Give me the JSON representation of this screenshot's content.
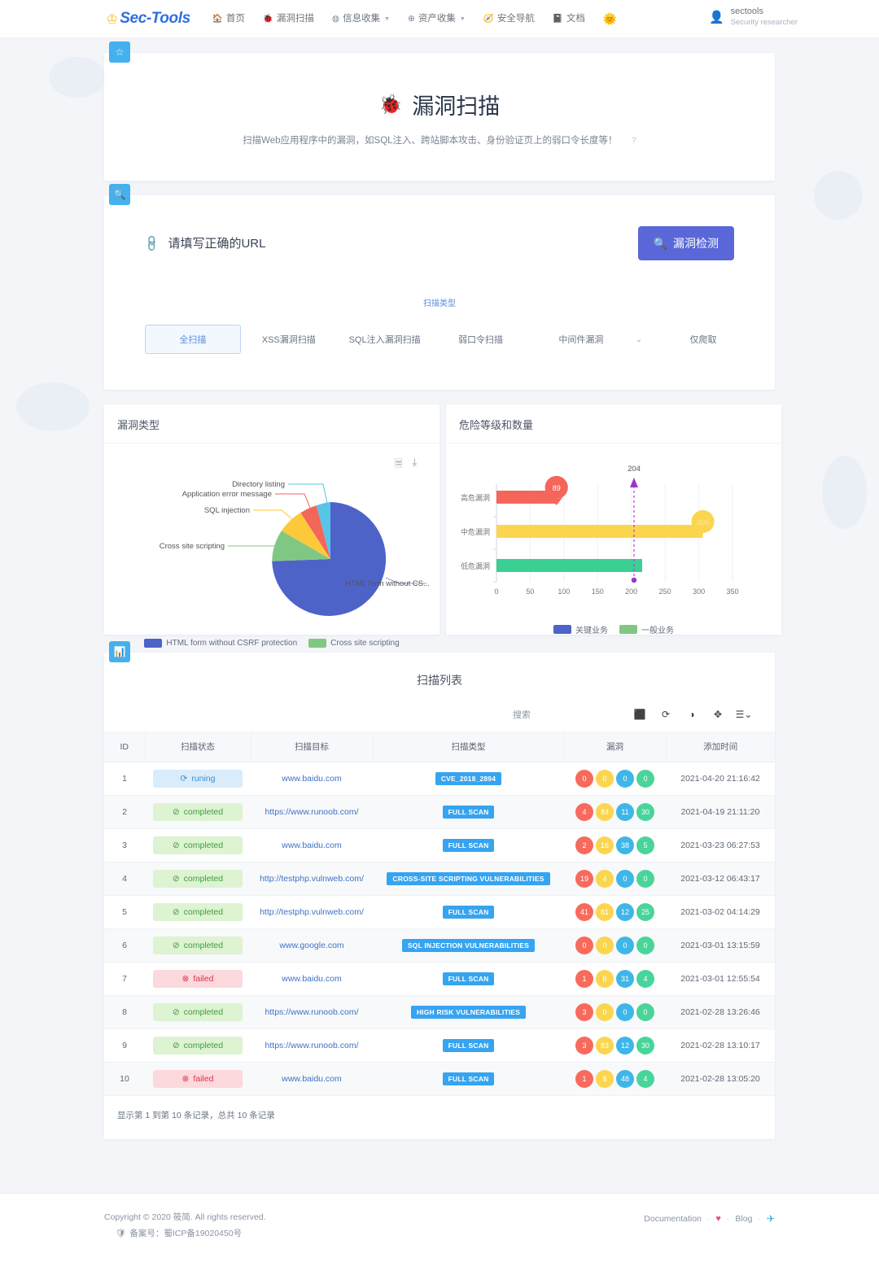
{
  "nav": {
    "brand": "Sec-Tools",
    "crown_icon": "crown-icon",
    "items": [
      {
        "label": "首页",
        "icon": "home-icon",
        "caret": false
      },
      {
        "label": "漏洞扫描",
        "icon": "bug-icon",
        "caret": false
      },
      {
        "label": "信息收集",
        "icon": "globe-icon",
        "caret": true
      },
      {
        "label": "资产收集",
        "icon": "network-icon",
        "caret": true
      },
      {
        "label": "安全导航",
        "icon": "compass-icon",
        "caret": false
      },
      {
        "label": "文档",
        "icon": "book-icon",
        "caret": false
      }
    ],
    "emoji": "🌞",
    "user": {
      "name": "sectools",
      "role": "Security researcher",
      "avatar_icon": "user-avatar-icon"
    }
  },
  "hero": {
    "title": "漏洞扫描",
    "icon": "bug-icon",
    "subtitle": "扫描Web应用程序中的漏洞，如SQL注入、跨站脚本攻击、身份验证页上的弱口令长度等！",
    "help": "?",
    "tab_icon": "star-icon"
  },
  "form": {
    "tab_icon": "search-icon",
    "url_placeholder": "请填写正确的URL",
    "url_value": "",
    "link_icon": "link-icon",
    "scan_button": "漏洞检测",
    "scan_button_icon": "search-icon",
    "scan_type_label": "扫描类型",
    "types": [
      "全扫描",
      "XSS漏洞扫描",
      "SQL注入漏洞扫描",
      "弱口令扫描"
    ],
    "active_type": "全扫描",
    "select_value": "中间件漏洞",
    "crawl_only": "仅爬取"
  },
  "charts": {
    "pie_title": "漏洞类型",
    "bar_title": "危险等级和数量",
    "tools": [
      "document-icon",
      "download-icon"
    ]
  },
  "chart_data": [
    {
      "type": "pie",
      "title": "漏洞类型",
      "categories": [
        "HTML form without CSRF protection",
        "Cross site scripting",
        "SQL injection",
        "Application error message",
        "Directory listing"
      ],
      "values": [
        68,
        15,
        8,
        5,
        4
      ],
      "colors": [
        "#4e63c8",
        "#81c784",
        "#fcc93b",
        "#f4655a",
        "#58c4e8"
      ],
      "labels": [
        "HTML form without CS...",
        "Cross site scripting",
        "SQL injection",
        "Application error message",
        "Directory listing"
      ],
      "legend": [
        "HTML form without CSRF protection",
        "Cross site scripting",
        "SQL injection",
        "Application error message",
        "Directory listing"
      ],
      "legend_position": "bottom"
    },
    {
      "type": "bar",
      "orientation": "horizontal",
      "title": "危险等级和数量",
      "categories": [
        "高危漏洞",
        "中危漏洞",
        "低危漏洞"
      ],
      "values": [
        89,
        306,
        216
      ],
      "markers": [
        "89",
        "306",
        ""
      ],
      "colors": [
        "#f4655a",
        "#fcd54f",
        "#3ccf93"
      ],
      "xlabel": "",
      "ylabel": "",
      "xlim": [
        0,
        350
      ],
      "xticks": [
        0,
        50,
        100,
        150,
        200,
        250,
        300,
        350
      ],
      "threshold": {
        "value": 204,
        "label": "204",
        "color": "#c33bd4"
      },
      "legend": [
        {
          "name": "关键业务",
          "color": "#4e63c8"
        },
        {
          "name": "一般业务",
          "color": "#81c784"
        }
      ],
      "legend_position": "bottom",
      "grid": true
    }
  ],
  "list": {
    "tab_icon": "chart-icon",
    "title": "扫描列表",
    "search_placeholder": "搜索",
    "toolbar_icons": [
      "export-icon",
      "refresh-icon",
      "toggle-icon",
      "fullscreen-icon",
      "columns-icon"
    ],
    "columns": [
      "ID",
      "扫描状态",
      "扫描目标",
      "扫描类型",
      "漏洞",
      "添加时间"
    ],
    "rows": [
      {
        "id": "1",
        "status": "runing",
        "status_kind": "running",
        "target": "www.baidu.com",
        "type": "CVE_2018_2894",
        "vulns": [
          "0",
          "0",
          "0",
          "0"
        ],
        "time": "2021-04-20 21:16:42"
      },
      {
        "id": "2",
        "status": "completed",
        "status_kind": "completed",
        "target": "https://www.runoob.com/",
        "type": "FULL SCAN",
        "vulns": [
          "4",
          "84",
          "11",
          "30"
        ],
        "time": "2021-04-19 21:11:20"
      },
      {
        "id": "3",
        "status": "completed",
        "status_kind": "completed",
        "target": "www.baidu.com",
        "type": "FULL SCAN",
        "vulns": [
          "2",
          "16",
          "38",
          "5"
        ],
        "time": "2021-03-23 06:27:53"
      },
      {
        "id": "4",
        "status": "completed",
        "status_kind": "completed",
        "target": "http://testphp.vulnweb.com/",
        "type": "CROSS-SITE SCRIPTING VULNERABILITIES",
        "vulns": [
          "19",
          "4",
          "0",
          "0"
        ],
        "time": "2021-03-12 06:43:17"
      },
      {
        "id": "5",
        "status": "completed",
        "status_kind": "completed",
        "target": "http://testphp.vulnweb.com/",
        "type": "FULL SCAN",
        "vulns": [
          "41",
          "81",
          "12",
          "25"
        ],
        "time": "2021-03-02 04:14:29"
      },
      {
        "id": "6",
        "status": "completed",
        "status_kind": "completed",
        "target": "www.google.com",
        "type": "SQL INJECTION VULNERABILITIES",
        "vulns": [
          "0",
          "0",
          "0",
          "0"
        ],
        "time": "2021-03-01 13:15:59"
      },
      {
        "id": "7",
        "status": "failed",
        "status_kind": "failed",
        "target": "www.baidu.com",
        "type": "FULL SCAN",
        "vulns": [
          "1",
          "6",
          "31",
          "4"
        ],
        "time": "2021-03-01 12:55:54"
      },
      {
        "id": "8",
        "status": "completed",
        "status_kind": "completed",
        "target": "https://www.runoob.com/",
        "type": "HIGH RISK VULNERABILITIES",
        "vulns": [
          "3",
          "0",
          "0",
          "0"
        ],
        "time": "2021-02-28 13:26:46"
      },
      {
        "id": "9",
        "status": "completed",
        "status_kind": "completed",
        "target": "https://www.runoob.com/",
        "type": "FULL SCAN",
        "vulns": [
          "3",
          "83",
          "12",
          "30"
        ],
        "time": "2021-02-28 13:10:17"
      },
      {
        "id": "10",
        "status": "failed",
        "status_kind": "failed",
        "target": "www.baidu.com",
        "type": "FULL SCAN",
        "vulns": [
          "1",
          "8",
          "48",
          "4"
        ],
        "time": "2021-02-28 13:05:20"
      }
    ],
    "footer": "显示第 1 到第 10 条记录，总共 10 条记录"
  },
  "footer": {
    "copyright": "Copyright © 2020 筱简. All rights reserved.",
    "icp": "备案号：蜀ICP备19020450号",
    "icp_icon": "police-badge-icon",
    "links": {
      "documentation": "Documentation",
      "blog": "Blog"
    },
    "heart_icon": "heart-icon",
    "telegram_icon": "telegram-icon",
    "separator": "·"
  },
  "colors": {
    "accent": "#5a67d8",
    "link": "#3f72c4",
    "badge": "#36a4f0",
    "tab": "#45b0ee"
  }
}
